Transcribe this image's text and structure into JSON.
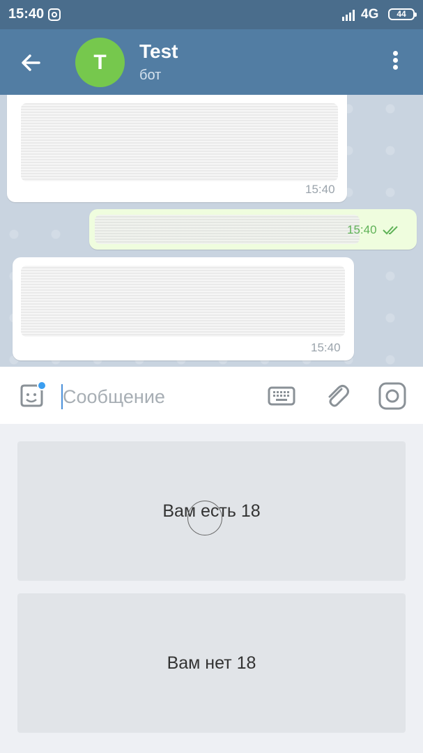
{
  "status_bar": {
    "time": "15:40",
    "network": "4G",
    "battery": "44"
  },
  "header": {
    "avatar_letter": "T",
    "title": "Test",
    "subtitle": "бот",
    "avatar_color": "#76c84d",
    "bar_color": "#527da3"
  },
  "messages": [
    {
      "direction": "incoming",
      "text_redacted": true,
      "time": "15:40"
    },
    {
      "direction": "outgoing",
      "text_redacted": true,
      "time": "15:40",
      "status": "read"
    },
    {
      "direction": "incoming",
      "text_redacted": true,
      "time": "15:40"
    }
  ],
  "input": {
    "placeholder": "Сообщение",
    "value": ""
  },
  "reply_keyboard": {
    "buttons": [
      {
        "label": "Вам есть 18"
      },
      {
        "label": "Вам нет 18"
      }
    ]
  },
  "icons": [
    "instagram-icon",
    "signal-icon",
    "back-arrow-icon",
    "more-vert-icon",
    "sticker-icon",
    "keyboard-icon",
    "paperclip-icon",
    "camera-icon",
    "double-check-icon"
  ]
}
